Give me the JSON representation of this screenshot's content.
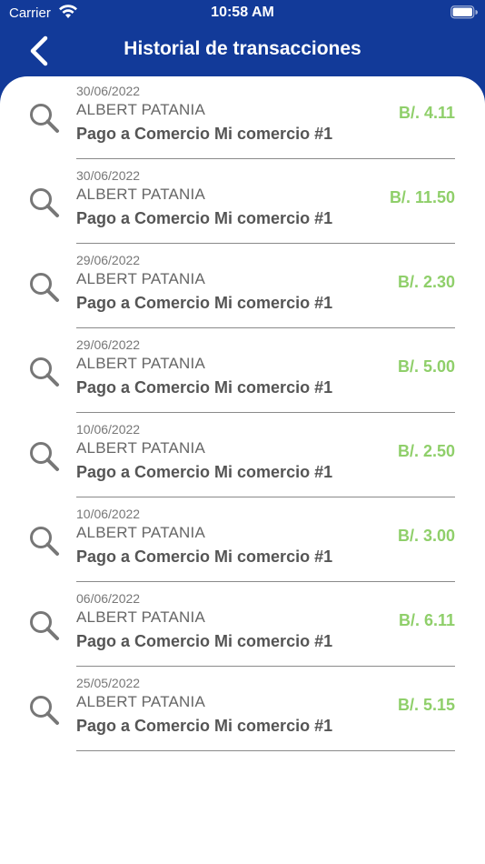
{
  "status_bar": {
    "carrier": "Carrier",
    "time": "10:58 AM",
    "icons": [
      "wifi-icon",
      "battery-icon"
    ]
  },
  "nav": {
    "title": "Historial de transacciones",
    "back_icon": "chevron-left-icon"
  },
  "colors": {
    "header_bg": "#123a99",
    "amount": "#8fcf6a",
    "divider": "#8a8a8a"
  },
  "transactions": [
    {
      "date": "30/06/2022",
      "name": "ALBERT PATANIA",
      "description": "Pago a Comercio Mi comercio #1",
      "amount": "B/. 4.11",
      "icon": "search-icon"
    },
    {
      "date": "30/06/2022",
      "name": "ALBERT PATANIA",
      "description": "Pago a Comercio Mi comercio #1",
      "amount": "B/. 11.50",
      "icon": "search-icon"
    },
    {
      "date": "29/06/2022",
      "name": "ALBERT PATANIA",
      "description": "Pago a Comercio Mi comercio #1",
      "amount": "B/. 2.30",
      "icon": "search-icon"
    },
    {
      "date": "29/06/2022",
      "name": "ALBERT PATANIA",
      "description": "Pago a Comercio Mi comercio #1",
      "amount": "B/. 5.00",
      "icon": "search-icon"
    },
    {
      "date": "10/06/2022",
      "name": "ALBERT PATANIA",
      "description": "Pago a Comercio Mi comercio #1",
      "amount": "B/. 2.50",
      "icon": "search-icon"
    },
    {
      "date": "10/06/2022",
      "name": "ALBERT PATANIA",
      "description": "Pago a Comercio Mi comercio #1",
      "amount": "B/. 3.00",
      "icon": "search-icon"
    },
    {
      "date": "06/06/2022",
      "name": "ALBERT PATANIA",
      "description": "Pago a Comercio Mi comercio #1",
      "amount": "B/. 6.11",
      "icon": "search-icon"
    },
    {
      "date": "25/05/2022",
      "name": "ALBERT PATANIA",
      "description": "Pago a Comercio Mi comercio #1",
      "amount": "B/. 5.15",
      "icon": "search-icon"
    }
  ]
}
